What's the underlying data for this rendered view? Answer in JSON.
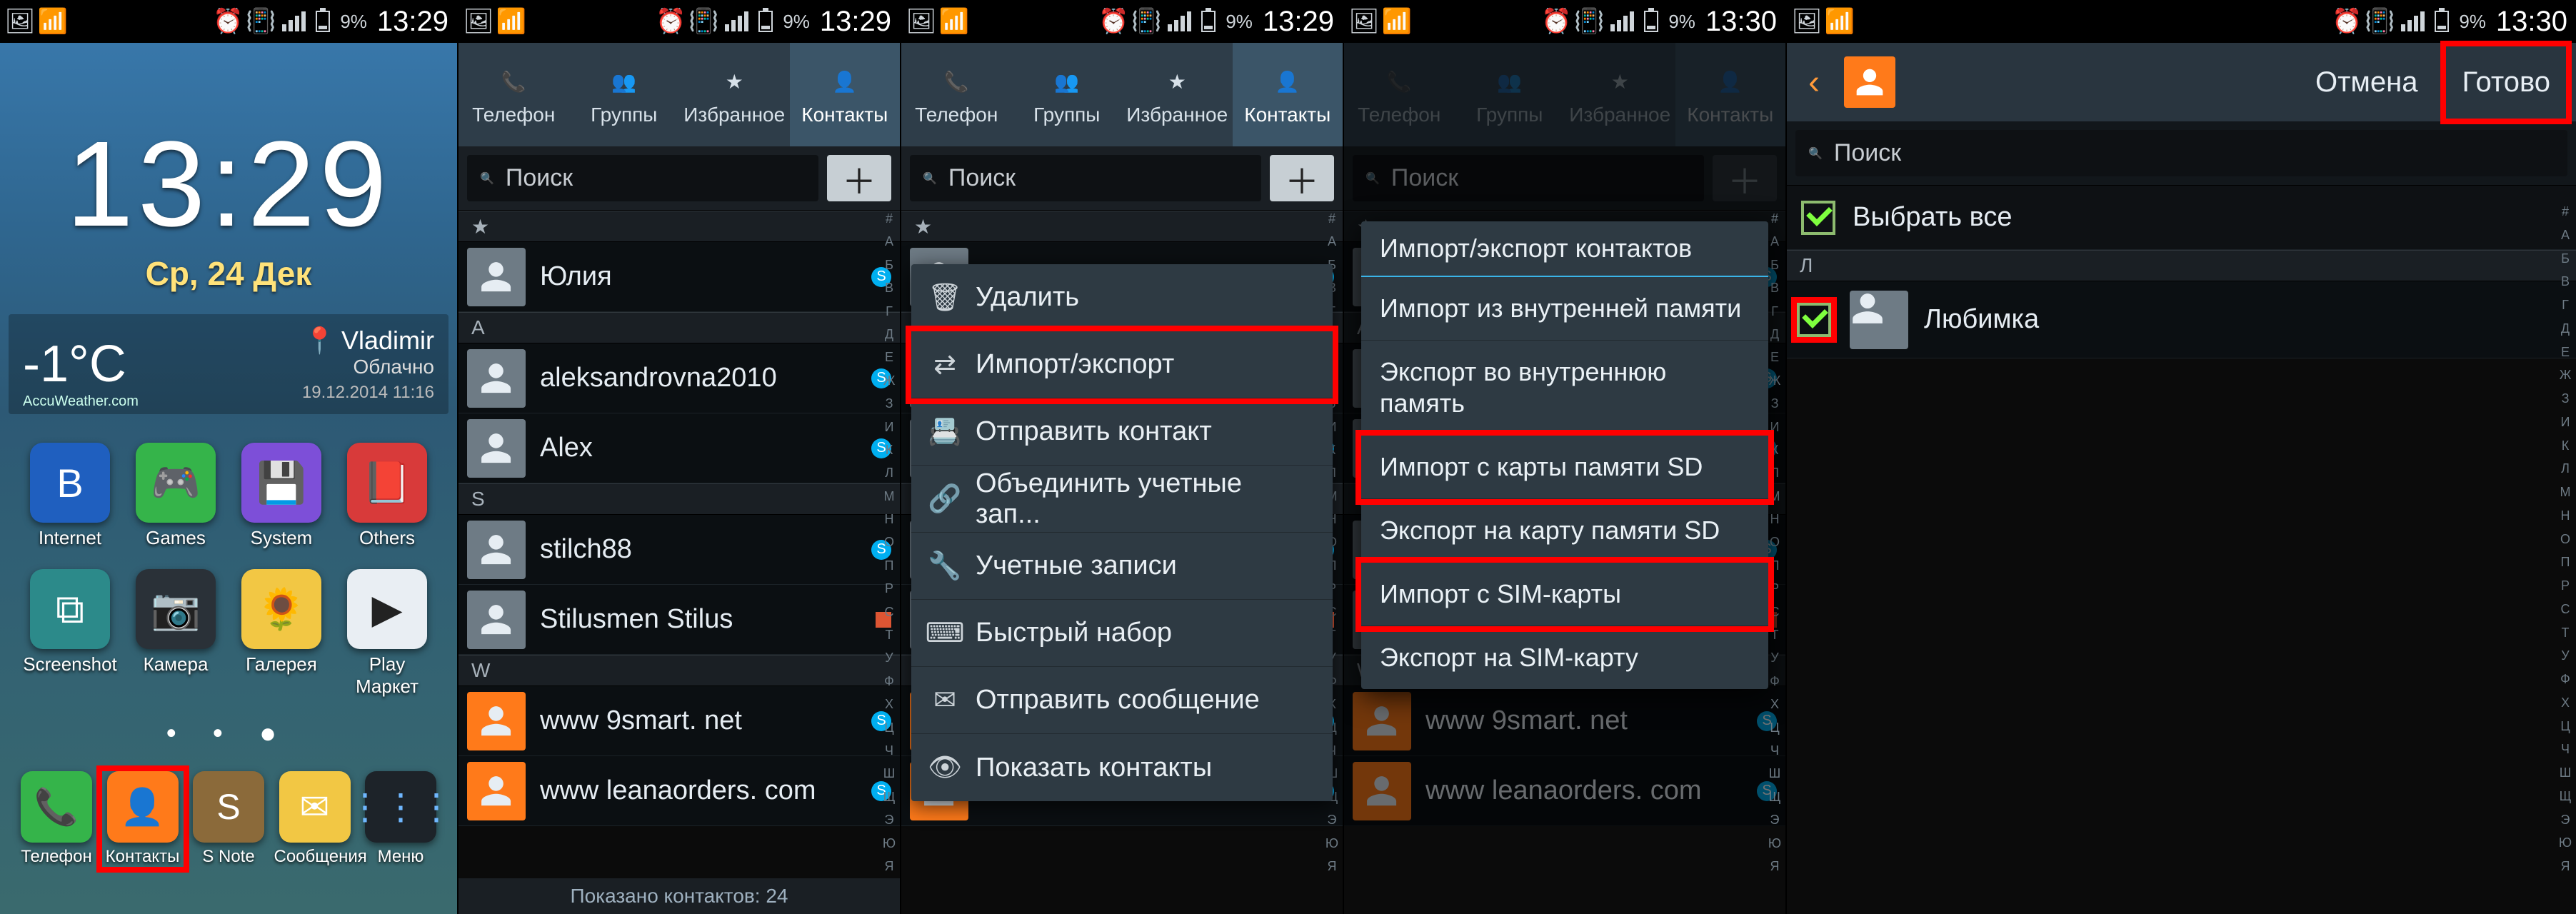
{
  "status": {
    "time_a": "13:29",
    "time_b": "13:30",
    "battery": "9%"
  },
  "home": {
    "clock_time": "13:29",
    "clock_date": "Ср, 24 Дек",
    "weather": {
      "temp": "-1°C",
      "city": "Vladimir",
      "cond": "Облачно",
      "attr": "AccuWeather.com",
      "stamp": "19.12.2014 11:16"
    },
    "apps_row1": [
      {
        "label": "Internet",
        "color": "ico-blue",
        "glyph": "B"
      },
      {
        "label": "Games",
        "color": "ico-green",
        "glyph": "🎮"
      },
      {
        "label": "System",
        "color": "ico-purple",
        "glyph": "💾"
      },
      {
        "label": "Others",
        "color": "ico-red",
        "glyph": "📕"
      }
    ],
    "apps_row2": [
      {
        "label": "Screenshot",
        "color": "ico-teal",
        "glyph": "⧉"
      },
      {
        "label": "Камера",
        "color": "ico-dark",
        "glyph": "📷"
      },
      {
        "label": "Галерея",
        "color": "ico-yellow",
        "glyph": "🌻"
      },
      {
        "label": "Play Маркет",
        "color": "ico-white",
        "glyph": "▶"
      }
    ],
    "dock": [
      {
        "label": "Телефон",
        "color": "ico-green",
        "glyph": "📞"
      },
      {
        "label": "Контакты",
        "color": "ico-orange",
        "glyph": "👤",
        "hl": true
      },
      {
        "label": "S Note",
        "color": "ico-brown",
        "glyph": "S"
      },
      {
        "label": "Сообщения",
        "color": "ico-yellow",
        "glyph": "✉"
      },
      {
        "label": "Меню",
        "color": "ico-apps",
        "glyph": "⋮⋮⋮"
      }
    ]
  },
  "tabs": {
    "phone": "Телефон",
    "groups": "Группы",
    "fav": "Избранное",
    "contacts": "Контакты"
  },
  "search": {
    "placeholder": "Поиск"
  },
  "contacts_list": {
    "fav_icon_title": "★",
    "letters": [
      "A",
      "S",
      "W"
    ],
    "fav": [
      {
        "name": "Юлия",
        "skype": true
      }
    ],
    "A": [
      {
        "name": "aleksandrovna2010",
        "skype": true
      },
      {
        "name": "Alex",
        "skype": true
      }
    ],
    "S": [
      {
        "name": "stilch88",
        "skype": true
      },
      {
        "name": "Stilusmen Stilus",
        "g": true
      }
    ],
    "W": [
      {
        "name": "www 9smart. net",
        "skype": true
      },
      {
        "name": "www leanaorders. com",
        "skype": true
      }
    ],
    "footer": "Показано контактов: 24",
    "rail": [
      "#",
      "A",
      "Б",
      "В",
      "Г",
      "Д",
      "Е",
      "Ж",
      "З",
      "И",
      "К",
      "Л",
      "М",
      "Н",
      "О",
      "П",
      "Р",
      "С",
      "Т",
      "У",
      "Ф",
      "Х",
      "Ц",
      "Ч",
      "Ш",
      "Щ",
      "Э",
      "Ю",
      "Я"
    ]
  },
  "ctx": {
    "items": [
      {
        "label": "Удалить",
        "icon": "trash"
      },
      {
        "label": "Импорт/экспорт",
        "icon": "swap",
        "hl": true
      },
      {
        "label": "Отправить контакт",
        "icon": "card"
      },
      {
        "label": "Объединить учетные зап...",
        "icon": "link"
      },
      {
        "label": "Учетные записи",
        "icon": "wrench"
      },
      {
        "label": "Быстрый набор",
        "icon": "dial"
      },
      {
        "label": "Отправить сообщение",
        "icon": "msg"
      },
      {
        "label": "Показать контакты",
        "icon": "eye"
      }
    ]
  },
  "dlg": {
    "title": "Импорт/экспорт контактов",
    "items": [
      {
        "label": "Импорт из внутренней памяти"
      },
      {
        "label": "Экспорт во внутреннюю память"
      },
      {
        "label": "Импорт с карты памяти SD",
        "hl": true
      },
      {
        "label": "Экспорт на карту памяти SD"
      },
      {
        "label": "Импорт с SIM-карты",
        "hl": true
      },
      {
        "label": "Экспорт на SIM-карту"
      }
    ]
  },
  "select": {
    "cancel": "Отмена",
    "done": "Готово",
    "all": "Выбрать все",
    "letter": "Л",
    "contact": "Любимка"
  }
}
